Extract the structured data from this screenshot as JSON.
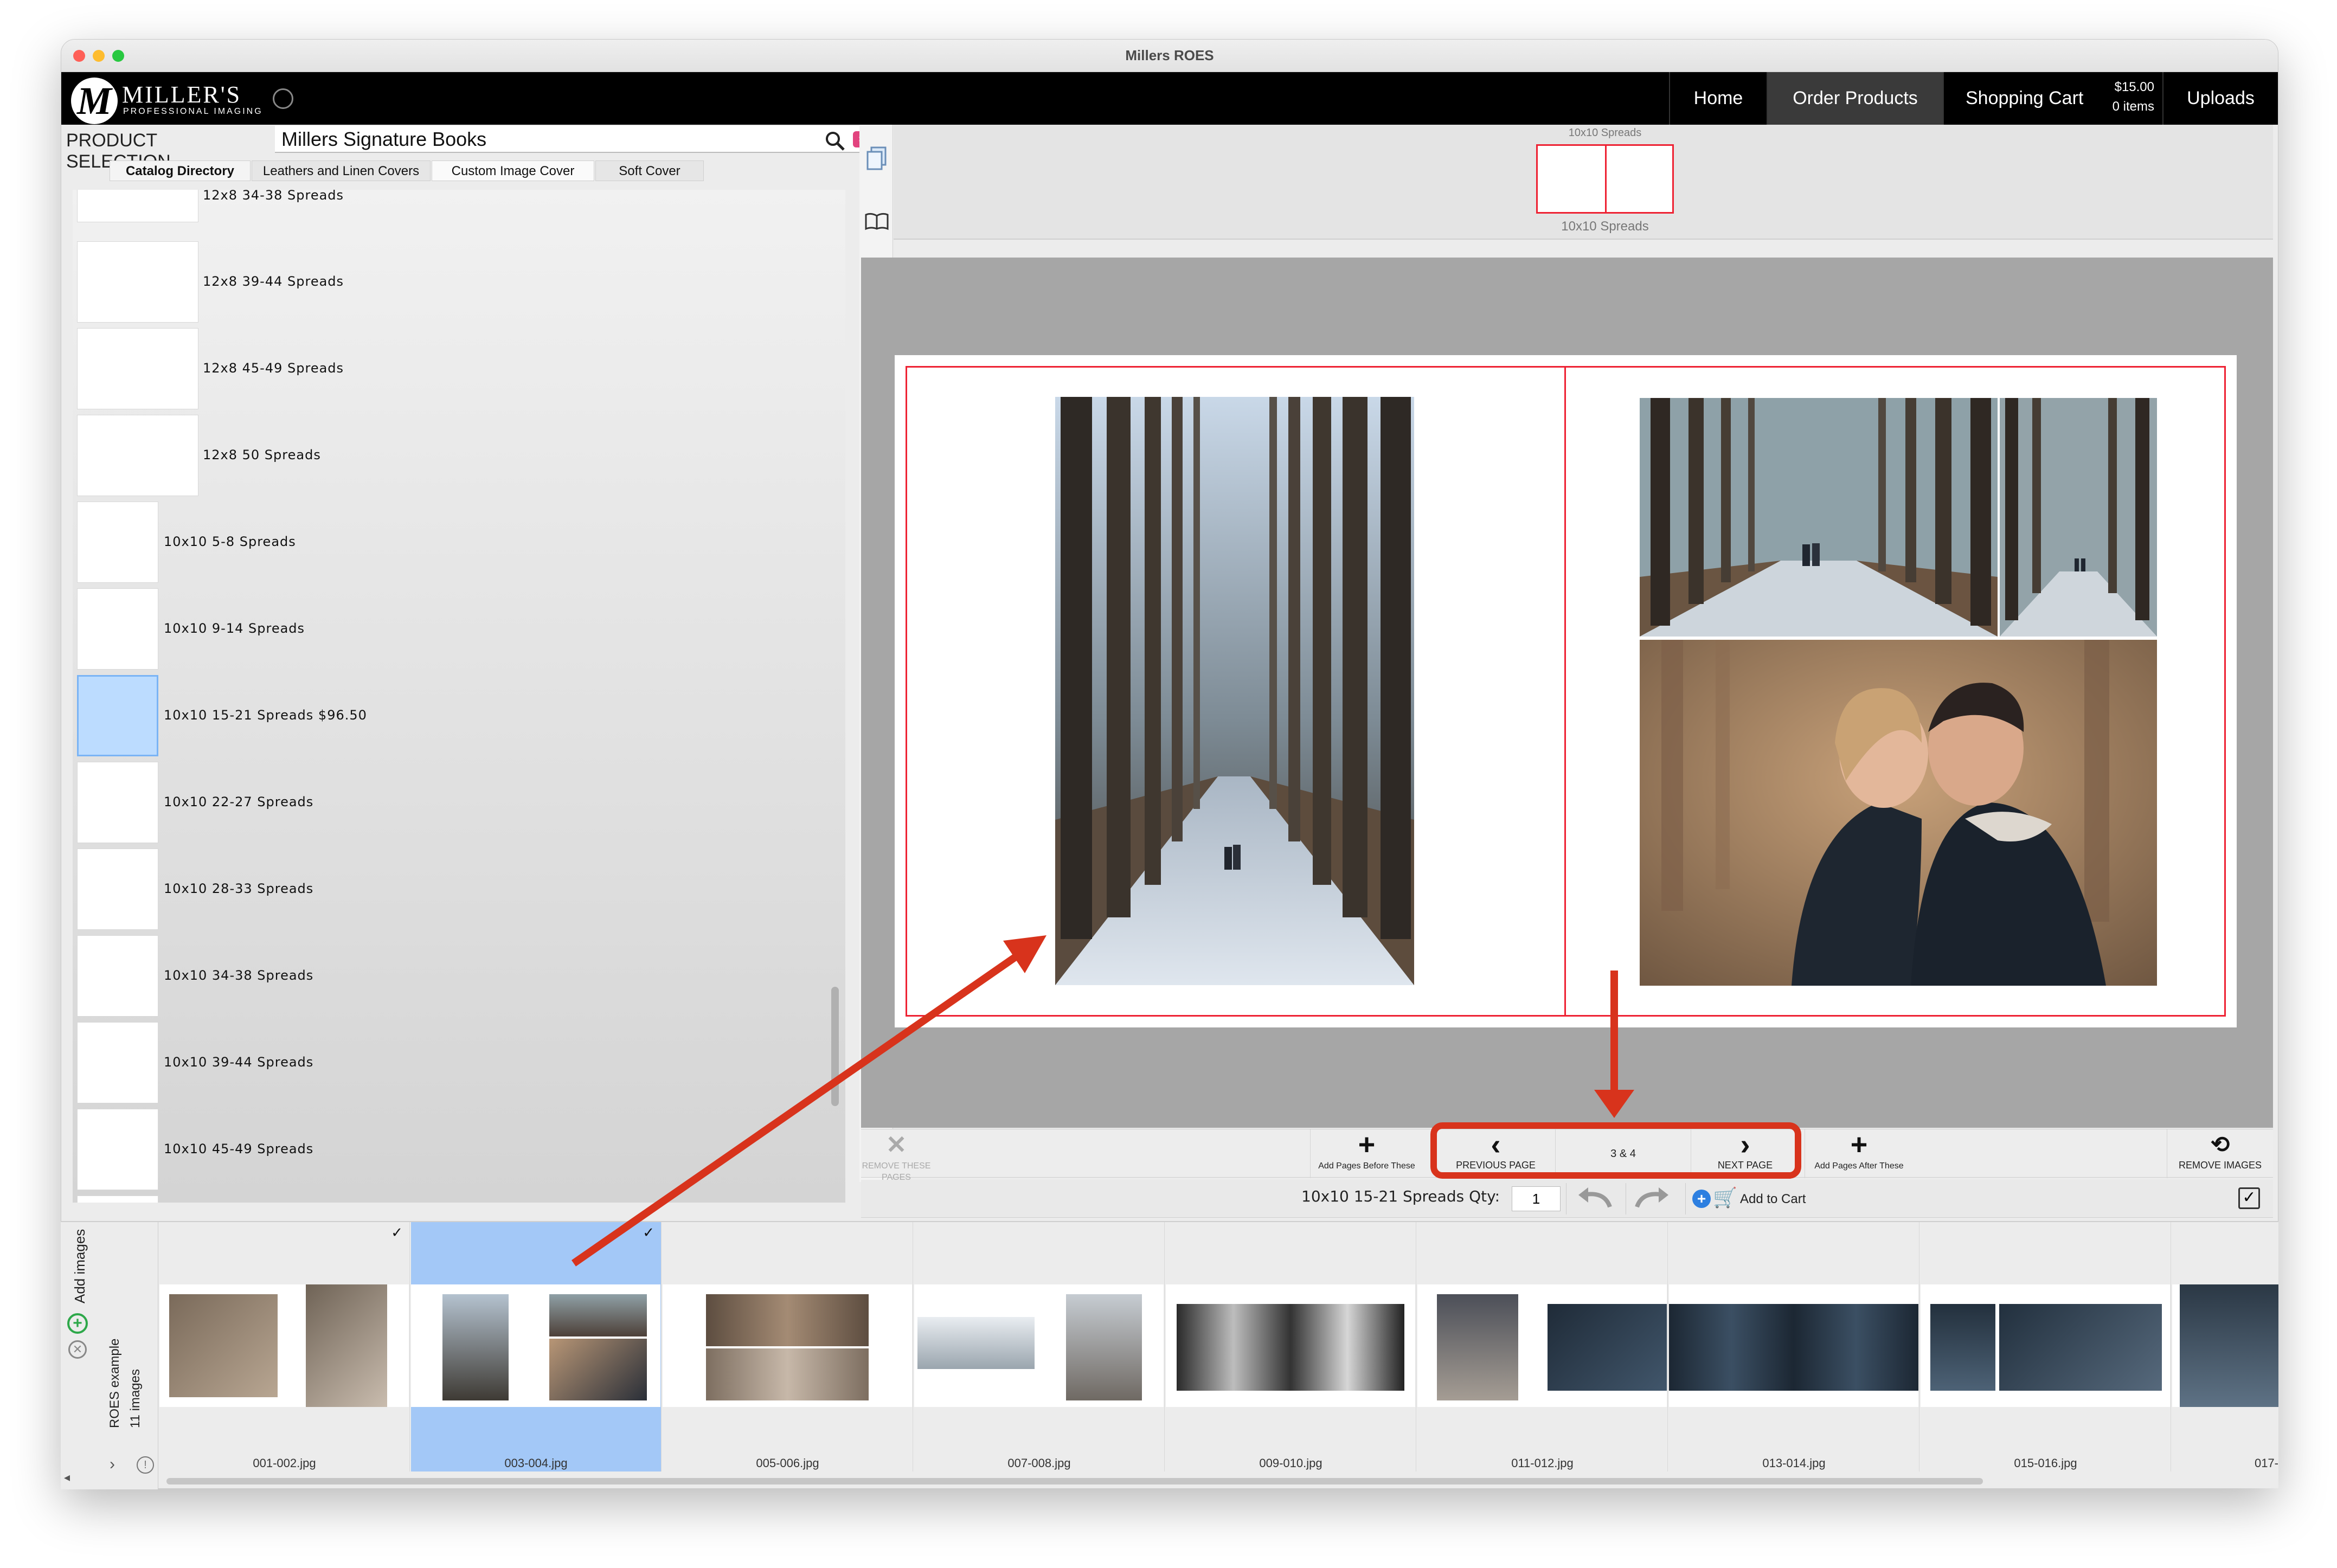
{
  "window": {
    "title": "Millers ROES"
  },
  "brand": {
    "name": "MILLER'S",
    "tagline": "PROFESSIONAL IMAGING",
    "monogram": "M"
  },
  "nav": {
    "items": [
      "Home",
      "Order Products",
      "Shopping Cart",
      "Uploads"
    ],
    "active": "Order Products",
    "cart_total": "$15.00",
    "cart_items": "0 items"
  },
  "product_selection": {
    "label": "PRODUCT SELECTION",
    "value": "Millers Signature Books",
    "tabs": [
      "Catalog Directory",
      "Leathers and Linen Covers",
      "Custom Image Cover",
      "Soft Cover"
    ]
  },
  "catalog": {
    "items": [
      "12x8 34-38 Spreads",
      "12x8 39-44 Spreads",
      "12x8 45-49 Spreads",
      "12x8 50 Spreads",
      "10x10 5-8 Spreads",
      "10x10 9-14 Spreads",
      "10x10 15-21 Spreads $96.50",
      "10x10 22-27 Spreads",
      "10x10 28-33 Spreads",
      "10x10 34-38 Spreads",
      "10x10 39-44 Spreads",
      "10x10 45-49 Spreads"
    ],
    "selected_index": 6
  },
  "spread_preview": {
    "top_label": "10x10 Spreads",
    "bottom_label": "10x10 Spreads"
  },
  "toolbar": {
    "remove_pages": "REMOVE THESE PAGES",
    "add_before": "Add Pages Before These",
    "previous": "PREVIOUS PAGE",
    "page_indicator": "3 & 4",
    "next": "NEXT PAGE",
    "add_after": "Add Pages After These",
    "remove_images": "REMOVE IMAGES"
  },
  "qty_row": {
    "label": "10x10 15-21 Spreads Qty:",
    "qty": "1",
    "add_to_cart": "Add to Cart"
  },
  "filmstrip": {
    "add_images": "Add images",
    "collection": "ROES example",
    "count": "11 images",
    "frames": [
      "001-002.jpg",
      "003-004.jpg",
      "005-006.jpg",
      "007-008.jpg",
      "009-010.jpg",
      "011-012.jpg",
      "013-014.jpg",
      "015-016.jpg",
      "017-"
    ],
    "selected_index": 1
  },
  "colors": {
    "accent_red": "#d8331c",
    "selection_blue": "#a3c8f7",
    "trim_red": "#e22233"
  }
}
